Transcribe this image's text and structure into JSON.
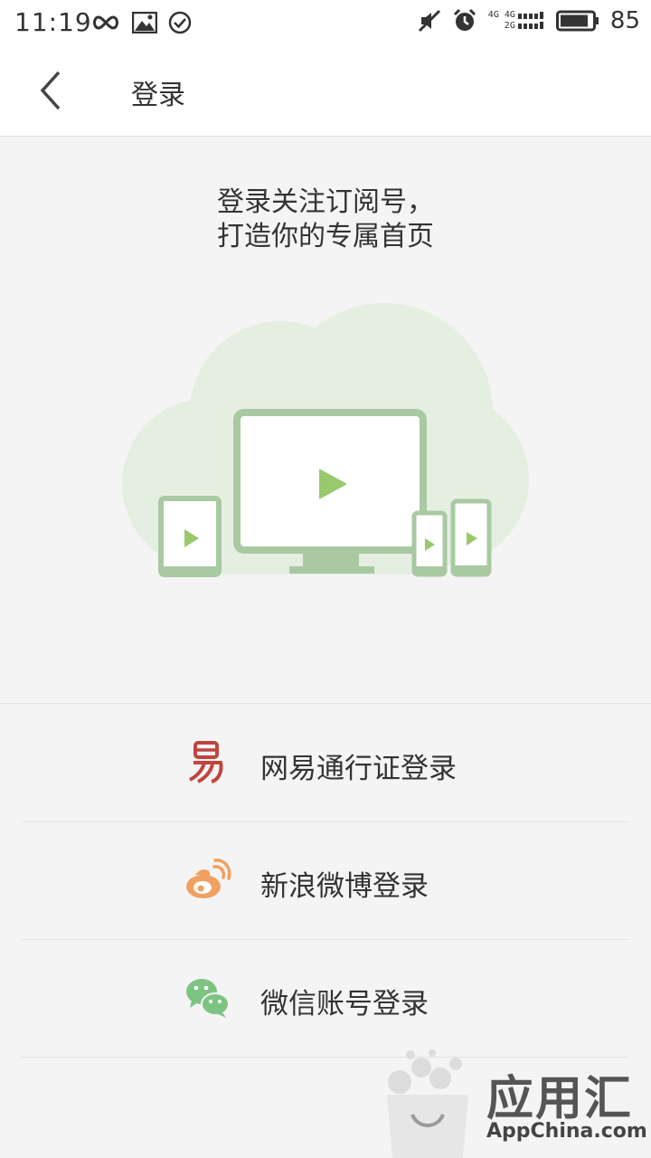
{
  "status_bar": {
    "time": "11:19",
    "battery_percent": "85",
    "network_top": "4G 4G",
    "network_bottom": "2G"
  },
  "app_bar": {
    "title": "登录"
  },
  "hero": {
    "line1": "登录关注订阅号，",
    "line2": "打造你的专属首页"
  },
  "login_options": [
    {
      "label": "网易通行证登录",
      "icon": "netease-icon",
      "color": "#c0453f"
    },
    {
      "label": "新浪微博登录",
      "icon": "weibo-icon",
      "color": "#f0a060"
    },
    {
      "label": "微信账号登录",
      "icon": "wechat-icon",
      "color": "#7dc483"
    }
  ],
  "watermark": {
    "cn": "应用汇",
    "en": "AppChina.com"
  },
  "colors": {
    "device_frame": "#a8c9a2",
    "cloud": "#e4efe1",
    "play": "#98c96b"
  }
}
